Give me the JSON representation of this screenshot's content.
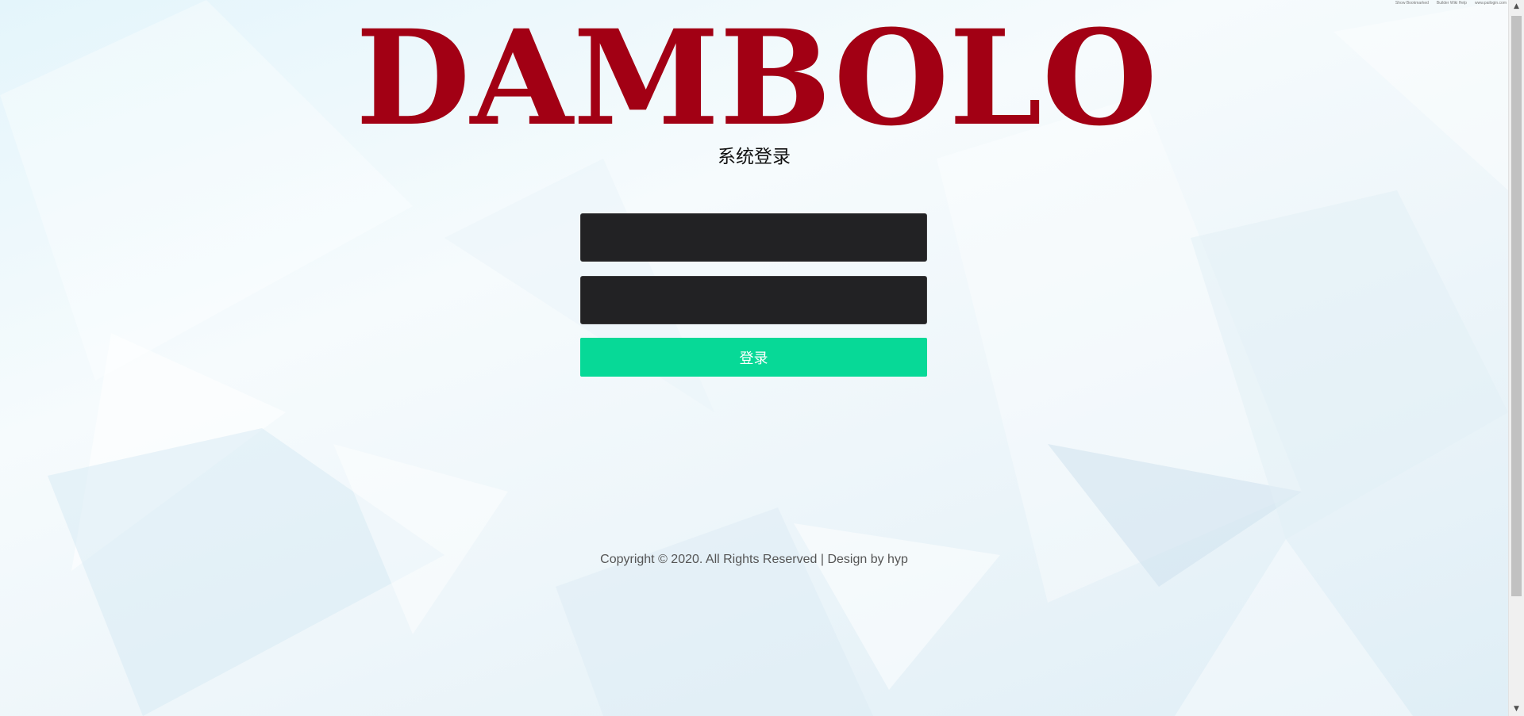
{
  "brand": {
    "logo_text": "DAMBOLO",
    "logo_color": "#a20014"
  },
  "login": {
    "title": "系统登录",
    "username_value": "",
    "password_value": "",
    "submit_label": "登录",
    "button_color": "#07d997"
  },
  "footer": {
    "copyright": "Copyright © 2020. All Rights Reserved | Design by hyp"
  },
  "top_links": [
    "Show Bookmarked",
    "Builder Wiki Help",
    "www.pailogin.com"
  ],
  "scrollbar": {
    "up_icon": "arrow-up-icon",
    "down_icon": "arrow-down-icon"
  }
}
